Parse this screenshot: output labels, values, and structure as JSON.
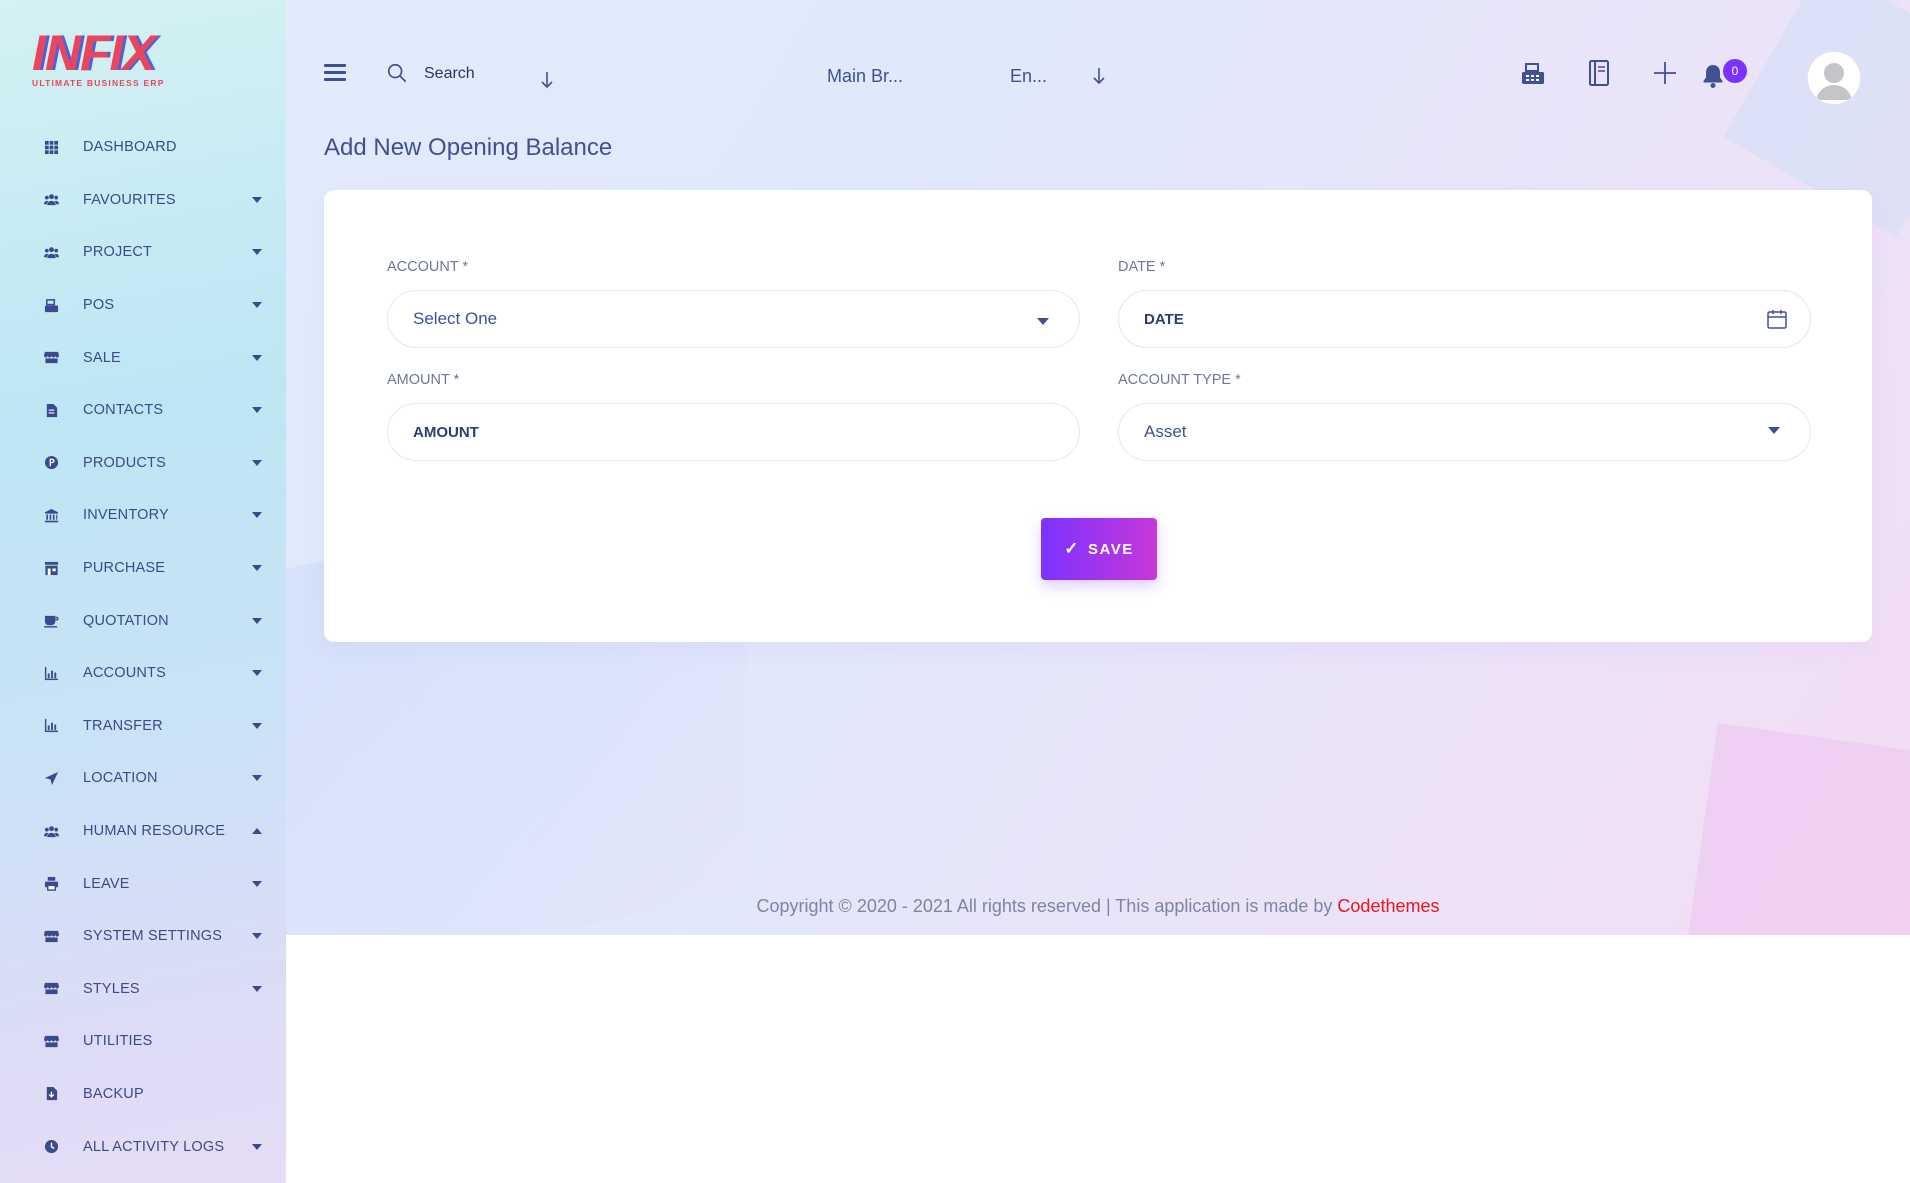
{
  "brand": {
    "logo_text": "INFIX",
    "tagline": "ULTIMATE BUSINESS ERP",
    "primary_color": "#7c32ff",
    "accent_color": "#e9465e",
    "text_color": "#415094"
  },
  "sidebar": {
    "items": [
      {
        "label": "DASHBOARD",
        "icon": "grid-icon",
        "caret": "none"
      },
      {
        "label": "FAVOURITES",
        "icon": "users-icon",
        "caret": "down"
      },
      {
        "label": "PROJECT",
        "icon": "users-icon",
        "caret": "down"
      },
      {
        "label": "POS",
        "icon": "cash-register-icon",
        "caret": "down"
      },
      {
        "label": "SALE",
        "icon": "store-icon",
        "caret": "down"
      },
      {
        "label": "CONTACTS",
        "icon": "file-icon",
        "caret": "down"
      },
      {
        "label": "PRODUCTS",
        "icon": "product-icon",
        "caret": "down"
      },
      {
        "label": "INVENTORY",
        "icon": "bank-icon",
        "caret": "down"
      },
      {
        "label": "PURCHASE",
        "icon": "shop-icon",
        "caret": "down"
      },
      {
        "label": "QUOTATION",
        "icon": "coffee-icon",
        "caret": "down"
      },
      {
        "label": "ACCOUNTS",
        "icon": "chart-icon",
        "caret": "down"
      },
      {
        "label": "TRANSFER",
        "icon": "chart-icon",
        "caret": "down"
      },
      {
        "label": "LOCATION",
        "icon": "location-arrow-icon",
        "caret": "down"
      },
      {
        "label": "HUMAN RESOURCE",
        "icon": "users-icon",
        "caret": "up"
      },
      {
        "label": "LEAVE",
        "icon": "printer-icon",
        "caret": "down"
      },
      {
        "label": "SYSTEM SETTINGS",
        "icon": "store-icon",
        "caret": "down"
      },
      {
        "label": "STYLES",
        "icon": "store-icon",
        "caret": "down"
      },
      {
        "label": "UTILITIES",
        "icon": "store-icon",
        "caret": "none"
      },
      {
        "label": "BACKUP",
        "icon": "file-download-icon",
        "caret": "none"
      },
      {
        "label": "ALL ACTIVITY LOGS",
        "icon": "clock-icon",
        "caret": "down"
      }
    ]
  },
  "header": {
    "search_placeholder": "Search",
    "branch_label": "Main Br...",
    "language_label": "En...",
    "notification_count": "0"
  },
  "page": {
    "title": "Add New Opening Balance"
  },
  "form": {
    "account": {
      "label": "ACCOUNT *",
      "value": "Select One"
    },
    "date": {
      "label": "DATE *",
      "value": "DATE"
    },
    "amount": {
      "label": "AMOUNT *",
      "value": "AMOUNT"
    },
    "account_type": {
      "label": "ACCOUNT TYPE *",
      "value": "Asset"
    },
    "save_label": "SAVE"
  },
  "footer": {
    "text": "Copyright © 2020 - 2021 All rights reserved | This application is made by ",
    "brand_link": "Codethemes"
  }
}
